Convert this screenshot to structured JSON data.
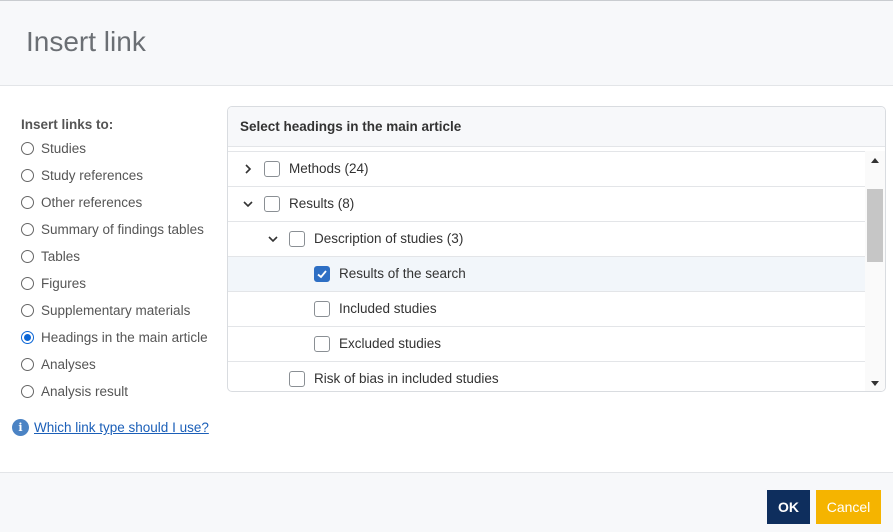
{
  "dialog": {
    "title": "Insert link"
  },
  "left": {
    "title": "Insert links to:",
    "options": [
      {
        "label": "Studies",
        "checked": false
      },
      {
        "label": "Study references",
        "checked": false
      },
      {
        "label": "Other references",
        "checked": false
      },
      {
        "label": "Summary of findings tables",
        "checked": false
      },
      {
        "label": "Tables",
        "checked": false
      },
      {
        "label": "Figures",
        "checked": false
      },
      {
        "label": "Supplementary materials",
        "checked": false
      },
      {
        "label": "Headings in the main article",
        "checked": true
      },
      {
        "label": "Analyses",
        "checked": false
      },
      {
        "label": "Analysis result",
        "checked": false
      }
    ],
    "help_link": "Which link type should I use?"
  },
  "panel": {
    "title": "Select headings in the main article",
    "rows": [
      {
        "label": "Methods (24)",
        "level": 0,
        "expander": "collapsed",
        "checked": false,
        "selected": false
      },
      {
        "label": "Results (8)",
        "level": 0,
        "expander": "expanded",
        "checked": false,
        "selected": false
      },
      {
        "label": "Description of studies (3)",
        "level": 1,
        "expander": "expanded",
        "checked": false,
        "selected": false
      },
      {
        "label": "Results of the search",
        "level": 2,
        "expander": "none",
        "checked": true,
        "selected": true
      },
      {
        "label": "Included studies",
        "level": 2,
        "expander": "none",
        "checked": false,
        "selected": false
      },
      {
        "label": "Excluded studies",
        "level": 2,
        "expander": "none",
        "checked": false,
        "selected": false
      },
      {
        "label": "Risk of bias in included studies",
        "level": 1,
        "expander": "none",
        "checked": false,
        "selected": false
      }
    ]
  },
  "footer": {
    "ok_label": "OK",
    "cancel_label": "Cancel"
  },
  "colors": {
    "ok_bg": "#0e2e5d",
    "cancel_bg": "#f5b400",
    "accent": "#2e6fc4",
    "link": "#1b5fb8"
  }
}
